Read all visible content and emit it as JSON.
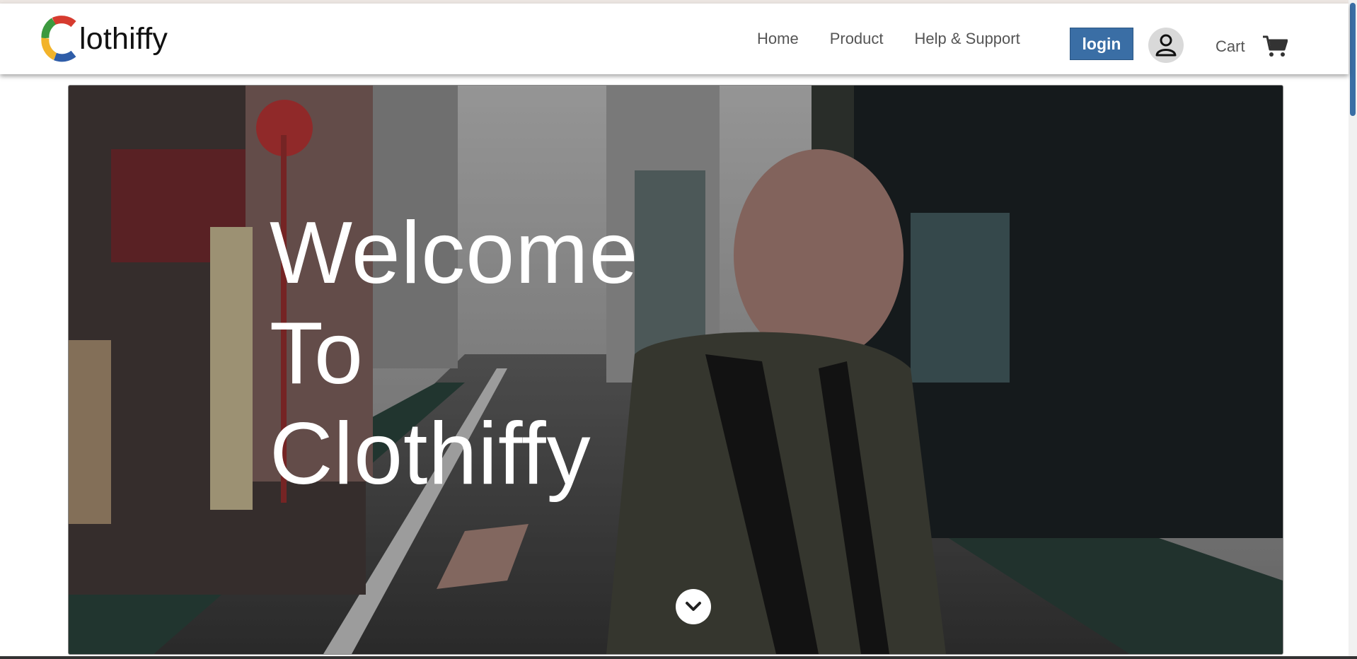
{
  "brand": {
    "name": "lothiffy",
    "logo_colors": [
      "#d63b2f",
      "#3c9a3f",
      "#f2b32a",
      "#2f5da8"
    ]
  },
  "nav": {
    "links": [
      "Home",
      "Product",
      "Help & Support"
    ],
    "login_label": "login",
    "cart_label": "Cart",
    "accent_color": "#3a6ea5"
  },
  "icons": {
    "user": "user-icon",
    "cart": "cart-icon",
    "scroll": "chevron-down-icon"
  },
  "hero": {
    "lines": [
      "Welcome",
      "To",
      "Clothiffy"
    ]
  }
}
